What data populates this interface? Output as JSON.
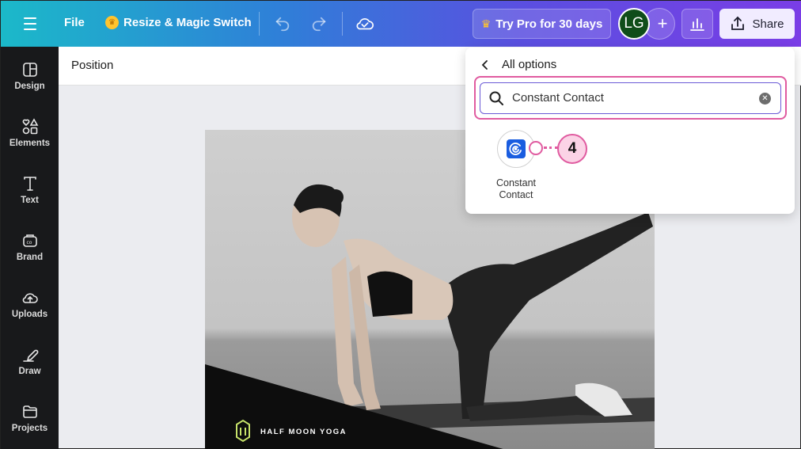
{
  "topbar": {
    "file_label": "File",
    "resize_label": "Resize & Magic Switch",
    "trypro_label": "Try Pro for 30 days",
    "avatar_initials": "LG",
    "share_label": "Share"
  },
  "sidebar": {
    "items": [
      {
        "label": "Design",
        "icon": "design-icon"
      },
      {
        "label": "Elements",
        "icon": "elements-icon"
      },
      {
        "label": "Text",
        "icon": "text-icon"
      },
      {
        "label": "Brand",
        "icon": "brand-icon"
      },
      {
        "label": "Uploads",
        "icon": "uploads-icon"
      },
      {
        "label": "Draw",
        "icon": "draw-icon"
      },
      {
        "label": "Projects",
        "icon": "projects-icon"
      }
    ]
  },
  "position_bar": {
    "label": "Position"
  },
  "share_panel": {
    "title": "All options",
    "search_value": "Constant Contact",
    "result": {
      "name": "Constant Contact",
      "line1": "Constant",
      "line2": "Contact"
    },
    "callout_number": "4"
  },
  "canvas": {
    "brand_text": "HALF MOON YOGA"
  },
  "colors": {
    "highlight": "#e05ba0",
    "sidebar_bg": "#18191b",
    "accent": "#6a5ad6"
  }
}
